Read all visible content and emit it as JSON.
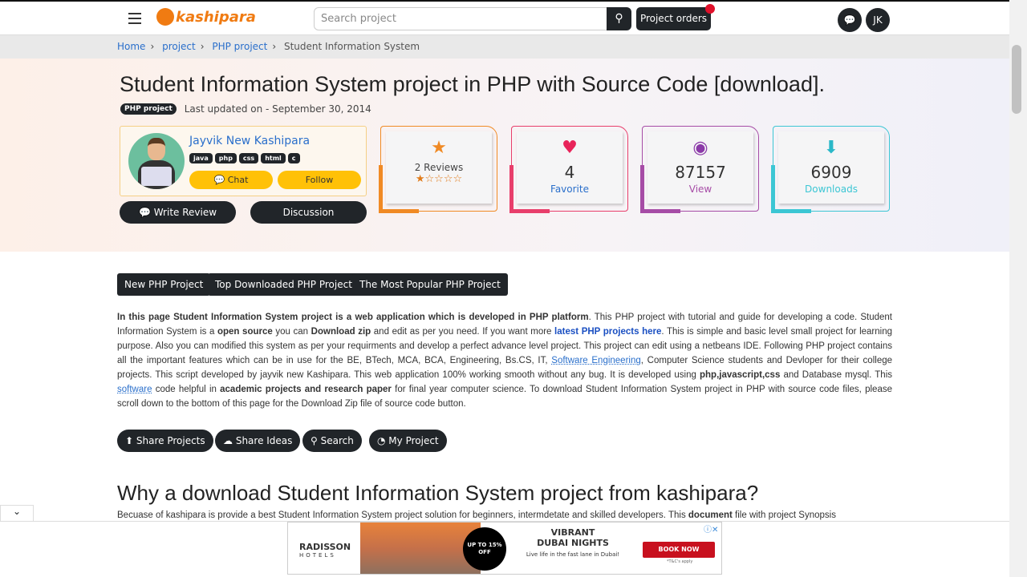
{
  "header": {
    "logo": "kashipara",
    "search_placeholder": "Search project",
    "orders": "Project orders",
    "avatar": "JK"
  },
  "breadcrumb": [
    "Home",
    "project",
    "PHP project",
    "Student Information System"
  ],
  "title": "Student Information System project in PHP with Source Code [download].",
  "category_badge": "PHP project",
  "updated": "Last updated on - September 30, 2014",
  "author": {
    "name": "Jayvik New Kashipara",
    "tags": [
      "java",
      "php",
      "css",
      "html",
      "c"
    ],
    "chat": "Chat",
    "follow": "Follow"
  },
  "actions": {
    "write_review": "Write Review",
    "discussion": "Discussion"
  },
  "stats": {
    "reviews": "2 Reviews",
    "rating": 1,
    "rating_stars": "★☆☆☆☆",
    "favorite_count": "4",
    "favorite_label": "Favorite",
    "view_count": "87157",
    "view_label": "View",
    "download_count": "6909",
    "download_label": "Downloads"
  },
  "colors": {
    "reviews": "#f08a24",
    "favorite": "#e83e6b",
    "view": "#a64ca6",
    "downloads": "#3cc6d4"
  },
  "project_buttons": [
    "New PHP Project",
    "Top Downloaded PHP Project",
    "The Most Popular PHP Project"
  ],
  "para": {
    "b1": "In this page Student Information System project is a web application which is developed in PHP platform",
    "t1": ". This PHP project with tutorial and guide for developing a code. Student Information System is a ",
    "b2": "open source",
    "t2": " you can ",
    "b3": "Download zip",
    "t3": " and edit as per you need. If you want more ",
    "link": "latest PHP projects here",
    "t4": ". This is simple and basic level small project for learning purpose. Also you can modified this system as per your requirments and develop a perfect advance level project. This project can edit using a netbeans IDE. Following PHP project contains all the important features which can be in use for the BE, BTech, MCA, BCA, Engineering, Bs.CS, IT, ",
    "sw1": "Software Engineering",
    "t5": ", Computer Science students and Devloper for their college projects. This script developed by jayvik new Kashipara. This web application 100% working smooth without any bug. It is developed using ",
    "b4": "php,javascript,css",
    "t6": " and Database mysql. This ",
    "sw2": "software",
    "t7": " code helpful in ",
    "b5": "academic projects and research paper",
    "t8": " for final year computer science. To download Student Information System project in PHP with source code files, please scroll down to the bottom of this page for the Download Zip file of source code button."
  },
  "round_buttons": [
    "Share Projects",
    "Share Ideas",
    "Search",
    "My Project"
  ],
  "section_title": "Why a download Student Information System project from kashipara?",
  "section_text_a": "Becuase of kashipara is provide a best Student Information System project solution for beginners, intermdetate and skilled developers. This ",
  "section_text_b": "document",
  "section_text_c": " file with project Synopsis",
  "ad": {
    "brand": "RADISSON",
    "brand_sub": "HOTELS",
    "offer": "UP TO 15% OFF",
    "headline1": "VIBRANT",
    "headline2": "DUBAI NIGHTS",
    "tagline": "Live life in the fast lane in Dubai!",
    "cta": "BOOK NOW",
    "fine": "*T&C's apply"
  }
}
